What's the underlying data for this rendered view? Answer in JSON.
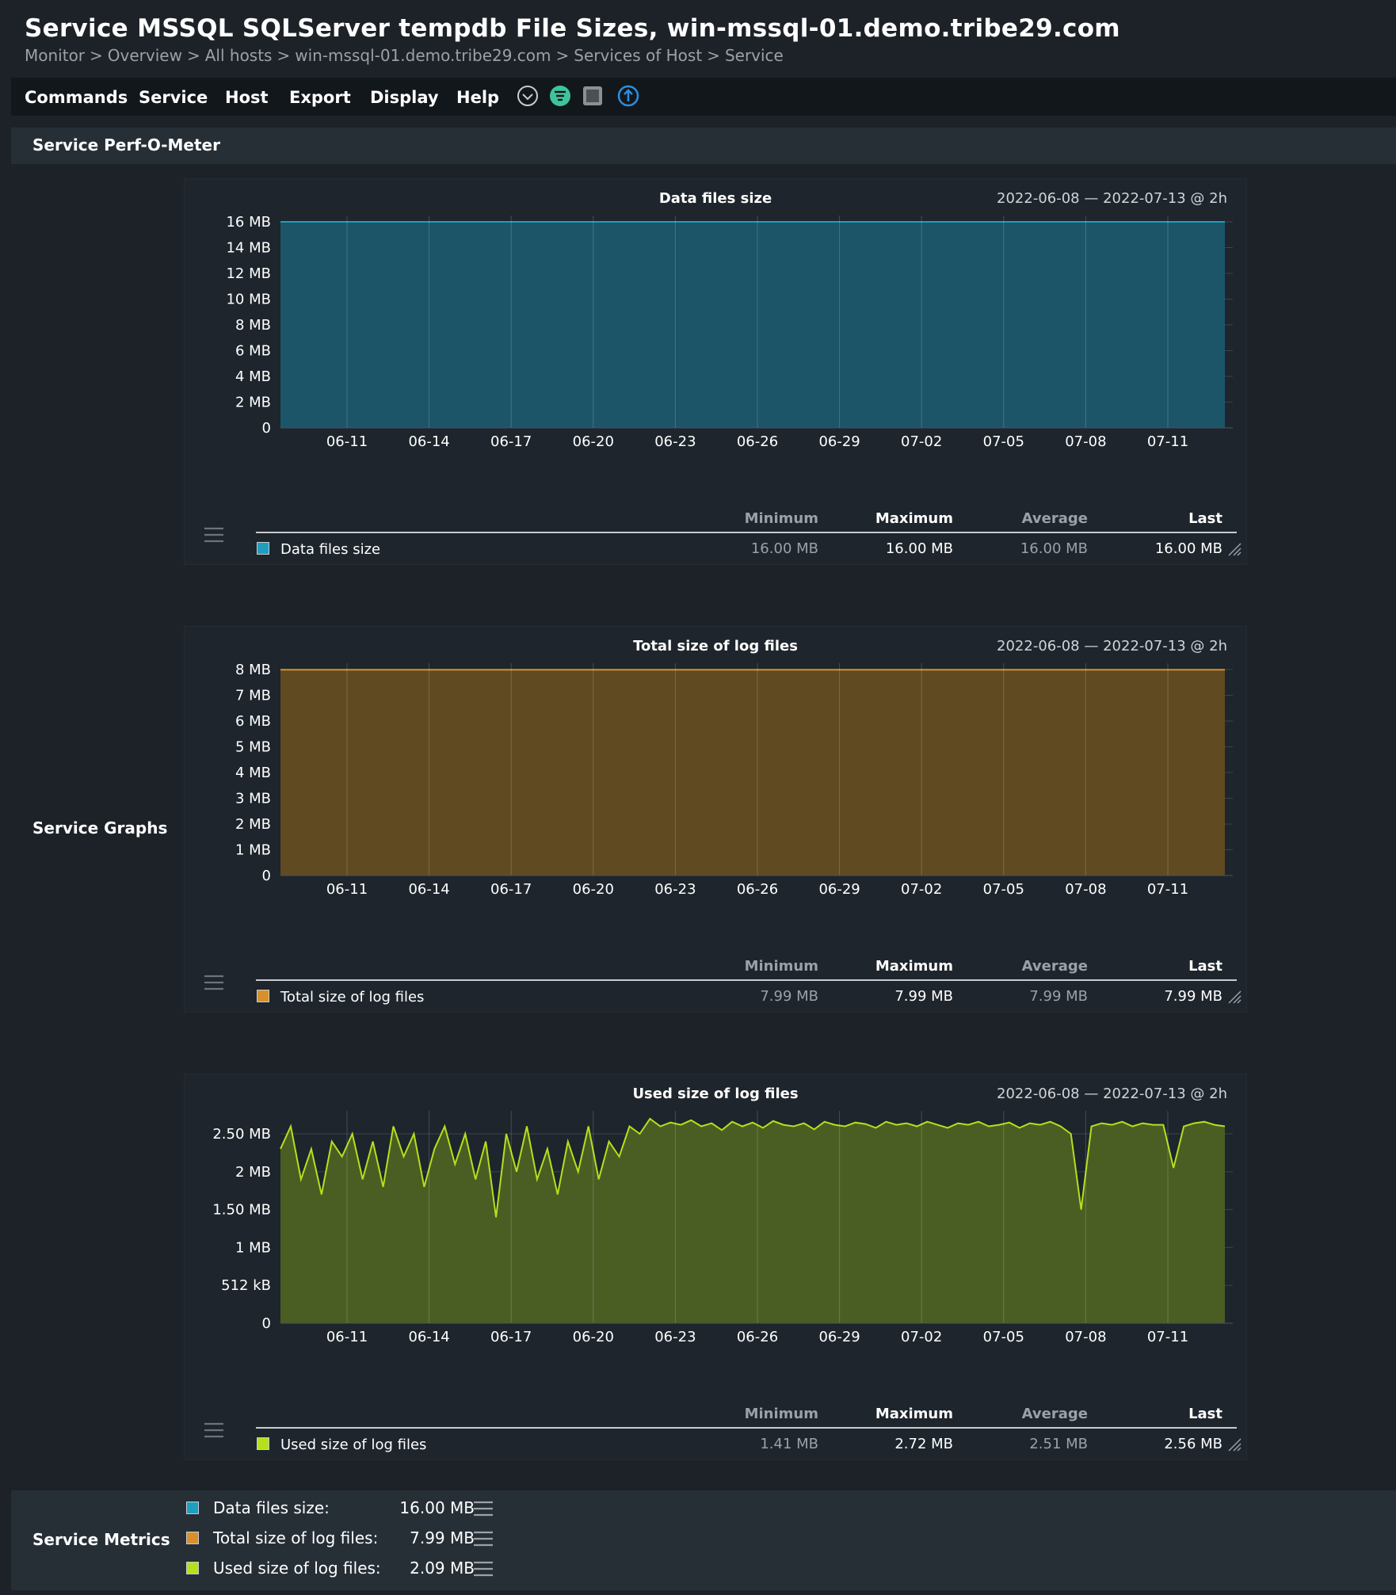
{
  "header": {
    "title": "Service MSSQL SQLServer tempdb File Sizes, win-mssql-01.demo.tribe29.com",
    "breadcrumb": [
      "Monitor",
      "Overview",
      "All hosts",
      "win-mssql-01.demo.tribe29.com",
      "Services of Host",
      "Service"
    ],
    "separator": ">"
  },
  "menu": [
    "Commands",
    "Service",
    "Host",
    "Export",
    "Display",
    "Help"
  ],
  "toolbar_icons": [
    "chevron-down-circle-icon",
    "filter-icon",
    "checkbox-square-icon",
    "arrow-up-circle-icon"
  ],
  "sections": {
    "perf": "Service Perf-O-Meter",
    "graphs": "Service Graphs",
    "metrics": "Service Metrics"
  },
  "legend_headers": [
    "Minimum",
    "Maximum",
    "Average",
    "Last"
  ],
  "chart_data": [
    {
      "type": "area",
      "title": "Data files size",
      "date_range": "2022-06-08 — 2022-07-13 @ 2h",
      "x_ticks": [
        "06-11",
        "06-14",
        "06-17",
        "06-20",
        "06-23",
        "06-26",
        "06-29",
        "07-02",
        "07-05",
        "07-08",
        "07-11"
      ],
      "y_ticks": [
        "16 MB",
        "14 MB",
        "12 MB",
        "10 MB",
        "8 MB",
        "6 MB",
        "4 MB",
        "2 MB",
        "0"
      ],
      "ylim_mb": [
        0,
        16
      ],
      "color": "#1e9fbf",
      "fill": "#1c5568",
      "series": [
        {
          "name": "Data files size",
          "values_mb": [
            16,
            16,
            16,
            16,
            16,
            16,
            16,
            16,
            16,
            16,
            16,
            16
          ]
        }
      ],
      "stats": {
        "min": "16.00 MB",
        "max": "16.00 MB",
        "avg": "16.00 MB",
        "last": "16.00 MB"
      }
    },
    {
      "type": "area",
      "title": "Total size of log files",
      "date_range": "2022-06-08 — 2022-07-13 @ 2h",
      "x_ticks": [
        "06-11",
        "06-14",
        "06-17",
        "06-20",
        "06-23",
        "06-26",
        "06-29",
        "07-02",
        "07-05",
        "07-08",
        "07-11"
      ],
      "y_ticks": [
        "8 MB",
        "7 MB",
        "6 MB",
        "5 MB",
        "4 MB",
        "3 MB",
        "2 MB",
        "1 MB",
        "0"
      ],
      "ylim_mb": [
        0,
        8
      ],
      "color": "#d9902a",
      "fill": "#604a22",
      "series": [
        {
          "name": "Total size of log files",
          "values_mb": [
            7.99,
            7.99,
            7.99,
            7.99,
            7.99,
            7.99,
            7.99,
            7.99,
            7.99,
            7.99,
            7.99,
            7.99
          ]
        }
      ],
      "stats": {
        "min": "7.99 MB",
        "max": "7.99 MB",
        "avg": "7.99 MB",
        "last": "7.99 MB"
      }
    },
    {
      "type": "area",
      "title": "Used size of log files",
      "date_range": "2022-06-08 — 2022-07-13 @ 2h",
      "x_ticks": [
        "06-11",
        "06-14",
        "06-17",
        "06-20",
        "06-23",
        "06-26",
        "06-29",
        "07-02",
        "07-05",
        "07-08",
        "07-11"
      ],
      "y_ticks": [
        "2.50 MB",
        "2 MB",
        "1.50 MB",
        "1 MB",
        "512 kB",
        "0"
      ],
      "ylim_mb": [
        0,
        2.72
      ],
      "color": "#b4e01c",
      "fill": "#4a5e24",
      "series": [
        {
          "name": "Used size of log files",
          "values_mb": [
            2.3,
            2.6,
            1.9,
            2.3,
            1.7,
            2.4,
            2.2,
            2.5,
            1.9,
            2.4,
            1.8,
            2.6,
            2.2,
            2.5,
            1.8,
            2.3,
            2.6,
            2.1,
            2.5,
            1.9,
            2.4,
            1.4,
            2.5,
            2.0,
            2.6,
            1.9,
            2.3,
            1.7,
            2.4,
            2.0,
            2.6,
            1.9,
            2.4,
            2.2,
            2.6,
            2.5,
            2.7,
            2.6,
            2.65,
            2.62,
            2.68,
            2.6,
            2.64,
            2.55,
            2.66,
            2.6,
            2.65,
            2.58,
            2.67,
            2.62,
            2.6,
            2.64,
            2.56,
            2.66,
            2.62,
            2.6,
            2.65,
            2.63,
            2.58,
            2.66,
            2.62,
            2.64,
            2.6,
            2.66,
            2.62,
            2.58,
            2.64,
            2.62,
            2.66,
            2.6,
            2.62,
            2.65,
            2.58,
            2.64,
            2.62,
            2.66,
            2.6,
            2.5,
            1.5,
            2.6,
            2.64,
            2.62,
            2.66,
            2.6,
            2.64,
            2.62,
            2.62,
            2.05,
            2.6,
            2.64,
            2.66,
            2.62,
            2.6
          ]
        }
      ],
      "stats": {
        "min": "1.41 MB",
        "max": "2.72 MB",
        "avg": "2.51 MB",
        "last": "2.56 MB"
      }
    }
  ],
  "metrics": [
    {
      "name": "Data files size:",
      "value": "16.00 MB",
      "color": "#1e9fbf"
    },
    {
      "name": "Total size of log files:",
      "value": "7.99 MB",
      "color": "#d9902a"
    },
    {
      "name": "Used size of log files:",
      "value": "2.09 MB",
      "color": "#b4e01c"
    }
  ]
}
